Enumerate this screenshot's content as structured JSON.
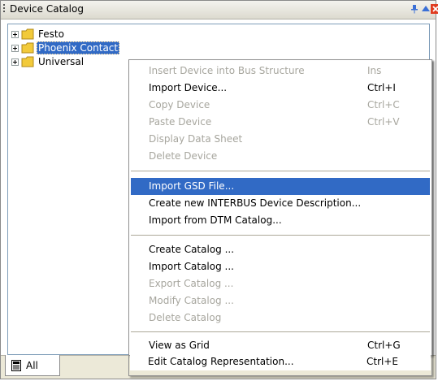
{
  "window": {
    "title": "Device Catalog",
    "colors": {
      "selection": "#316ac5",
      "folder": "#f2ca3a",
      "close": "#e03c1f",
      "pin": "#3a6fd6"
    }
  },
  "tree": {
    "items": [
      {
        "label": "Festo",
        "selected": false
      },
      {
        "label": "Phoenix Contact",
        "selected": true
      },
      {
        "label": "Universal",
        "selected": false
      }
    ]
  },
  "tabs": [
    {
      "label": "All",
      "icon": "sheet-icon"
    }
  ],
  "menu": {
    "items": [
      {
        "label": "Insert Device into Bus Structure",
        "shortcut": "Ins",
        "enabled": false
      },
      {
        "label": "Import Device...",
        "shortcut": "Ctrl+I",
        "enabled": true
      },
      {
        "label": "Copy Device",
        "shortcut": "Ctrl+C",
        "enabled": false
      },
      {
        "label": "Paste Device",
        "shortcut": "Ctrl+V",
        "enabled": false
      },
      {
        "label": "Display Data Sheet",
        "shortcut": "",
        "enabled": false
      },
      {
        "label": "Delete Device",
        "shortcut": "",
        "enabled": false
      },
      {
        "label": "Import GSD File...",
        "shortcut": "",
        "enabled": true,
        "highlighted": true
      },
      {
        "label": "Create new INTERBUS Device Description...",
        "shortcut": "",
        "enabled": true
      },
      {
        "label": "Import from DTM Catalog...",
        "shortcut": "",
        "enabled": true
      },
      {
        "label": "Create Catalog ...",
        "shortcut": "",
        "enabled": true
      },
      {
        "label": "Import Catalog ...",
        "shortcut": "",
        "enabled": true
      },
      {
        "label": "Export Catalog ...",
        "shortcut": "",
        "enabled": false
      },
      {
        "label": "Modify Catalog ...",
        "shortcut": "",
        "enabled": false
      },
      {
        "label": "Delete Catalog",
        "shortcut": "",
        "enabled": false
      },
      {
        "label": "View as Grid",
        "shortcut": "Ctrl+G",
        "enabled": true
      },
      {
        "label": "Edit Catalog Representation...",
        "shortcut": "Ctrl+E",
        "enabled": true
      }
    ]
  }
}
